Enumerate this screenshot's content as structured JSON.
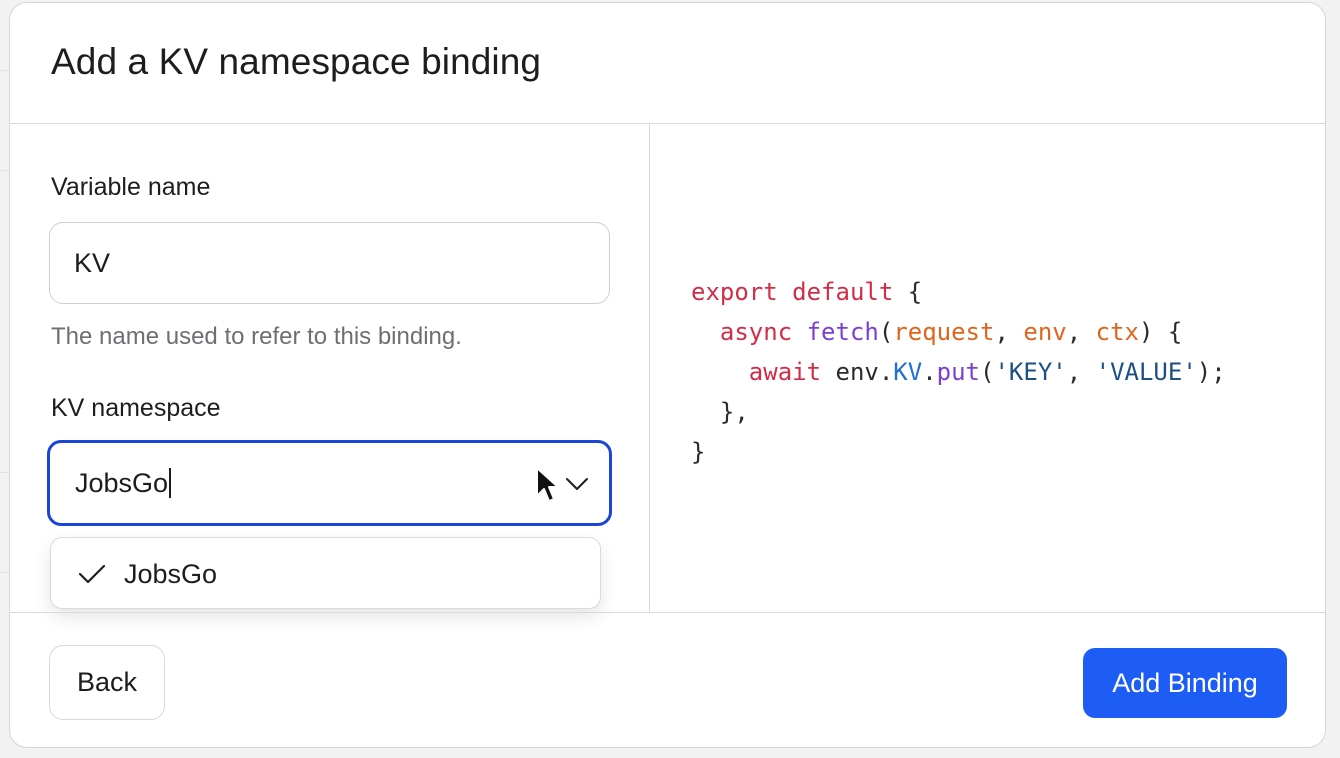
{
  "modal": {
    "title": "Add a KV namespace binding"
  },
  "variable": {
    "label": "Variable name",
    "value": "KV",
    "helper": "The name used to refer to this binding."
  },
  "namespace": {
    "label": "KV namespace",
    "value": "JobsGo",
    "options": [
      {
        "label": "JobsGo",
        "selected": true
      }
    ]
  },
  "code": {
    "line1": {
      "kw_export": "export",
      "kw_default": "default",
      "brace": " {"
    },
    "line2": {
      "kw_async": "async",
      "fn_fetch": "fetch",
      "p_open": "(",
      "param_request": "request",
      "c1": ", ",
      "param_env": "env",
      "c2": ", ",
      "param_ctx": "ctx",
      "p_close": ") {"
    },
    "line3": {
      "kw_await": "await",
      "obj_env": " env.",
      "prop_kv": "KV",
      "dot": ".",
      "fn_put": "put",
      "p_open": "(",
      "str_key": "'KEY'",
      "comma": ", ",
      "str_value": "'VALUE'",
      "p_close": ");"
    },
    "line4": "},",
    "line5": "}"
  },
  "footer": {
    "back_label": "Back",
    "add_label": "Add Binding"
  },
  "colors": {
    "primary": "#1d5cf5",
    "focus_border": "#1a45d9",
    "keyword": "#d22d47",
    "function": "#7b3fd1",
    "parameter": "#e0651c",
    "property": "#1f6fd6",
    "string": "#1b4f86"
  },
  "icons": {
    "combo": "chevron-down-icon",
    "option": "check-icon",
    "pointer": "mouse-cursor-icon"
  }
}
